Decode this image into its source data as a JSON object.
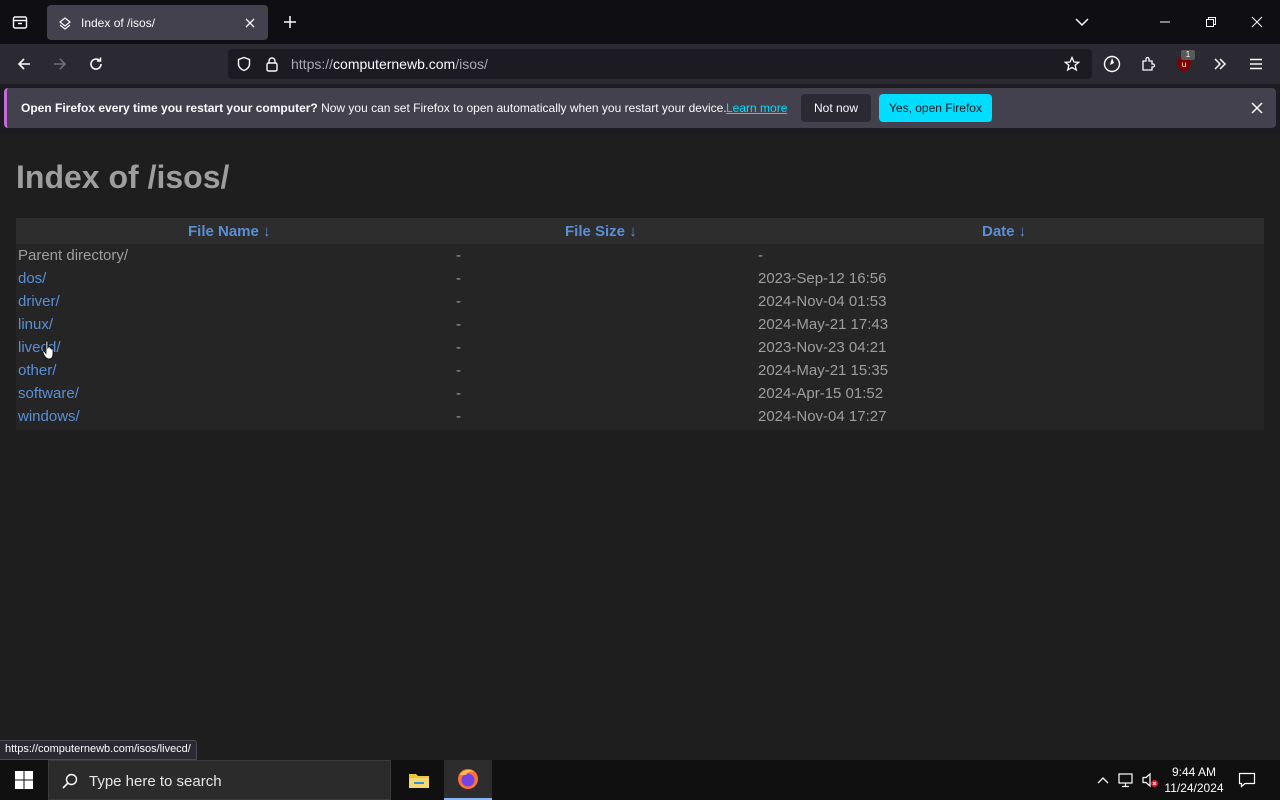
{
  "browser": {
    "tab": {
      "title": "Index of /isos/"
    },
    "url": {
      "scheme": "https://",
      "domain": "computernewb.com",
      "path": "/isos/"
    },
    "extension_badge": "1"
  },
  "notification": {
    "bold": "Open Firefox every time you restart your computer?",
    "text": " Now you can set Firefox to open automatically when you restart your device.",
    "learn_more": "Learn more",
    "not_now": "Not now",
    "yes": "Yes, open Firefox"
  },
  "page": {
    "title": "Index of /isos/",
    "columns": {
      "name": "File Name  ↓",
      "size": "File Size  ↓",
      "date": "Date  ↓"
    },
    "rows": [
      {
        "name": "Parent directory/",
        "size": "-",
        "date": "-"
      },
      {
        "name": "dos/",
        "size": "-",
        "date": "2023-Sep-12 16:56"
      },
      {
        "name": "driver/",
        "size": "-",
        "date": "2024-Nov-04 01:53"
      },
      {
        "name": "linux/",
        "size": "-",
        "date": "2024-May-21 17:43"
      },
      {
        "name": "livecd/",
        "size": "-",
        "date": "2023-Nov-23 04:21"
      },
      {
        "name": "other/",
        "size": "-",
        "date": "2024-May-21 15:35"
      },
      {
        "name": "software/",
        "size": "-",
        "date": "2024-Apr-15 01:52"
      },
      {
        "name": "windows/",
        "size": "-",
        "date": "2024-Nov-04 17:27"
      }
    ]
  },
  "statusbar": {
    "link": "https://computernewb.com/isos/livecd/"
  },
  "taskbar": {
    "search_placeholder": "Type here to search",
    "time": "9:44 AM",
    "date": "11/24/2024"
  },
  "colors": {
    "link": "#5a8fd6",
    "accent": "#00ddff",
    "notif_border": "#c56bd9"
  }
}
